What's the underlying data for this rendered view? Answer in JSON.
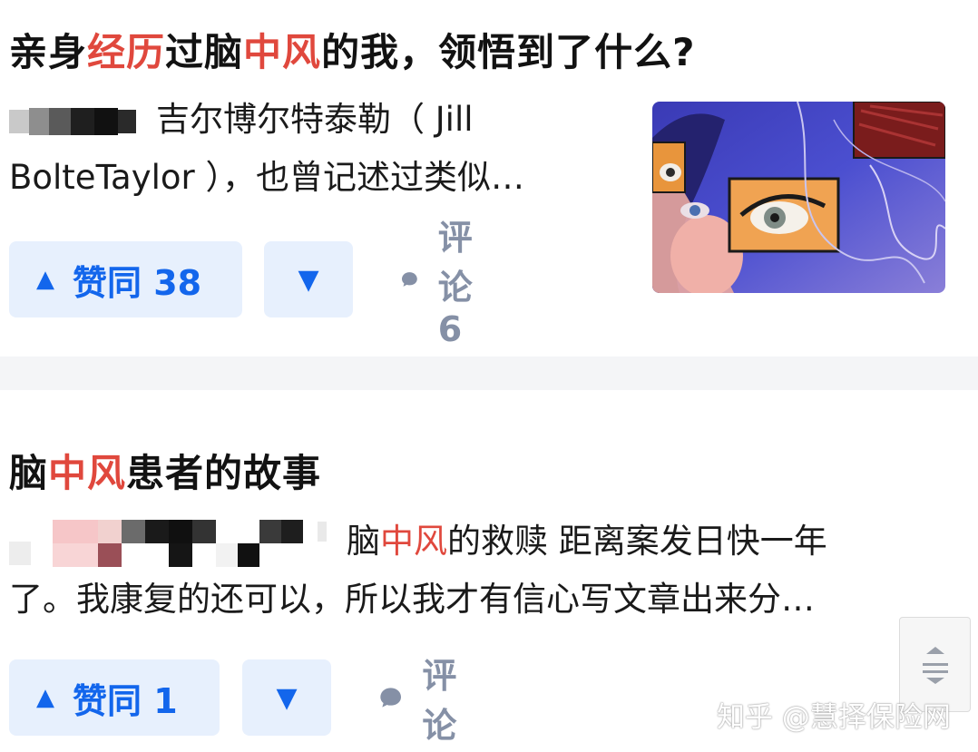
{
  "cards": [
    {
      "title_parts": [
        "亲身",
        "经历",
        "过脑",
        "中风",
        "的我，领悟到了什么?"
      ],
      "excerpt_line1": "吉尔博尔特泰勒（ Jill",
      "excerpt_line2": "BolteTaylor ），也曾记述过类似…",
      "upvote_label": "赞同 38",
      "comment_label": "评论 6",
      "thumbnail": "illustration-woman-face-eyes"
    },
    {
      "title_parts": [
        "脑",
        "中风",
        "患者的故事"
      ],
      "excerpt_line1_parts": [
        "脑",
        "中风",
        "的救赎 距离案发日快一年"
      ],
      "excerpt_line2": "了。我康复的还可以，所以我才有信心写文章出来分…",
      "upvote_label": "赞同 1",
      "comment_label": "评论"
    }
  ],
  "icons": {
    "upvote": "triangle-up-icon",
    "downvote": "triangle-down-icon",
    "comment": "speech-bubble-icon",
    "scroll": "scroll-top-icon"
  },
  "colors": {
    "highlight": "#e0483d",
    "vote_text": "#1366ec",
    "vote_bg": "#e7f0fd",
    "comment_gray": "#8590a6"
  },
  "watermark": "知乎 @慧择保险网"
}
